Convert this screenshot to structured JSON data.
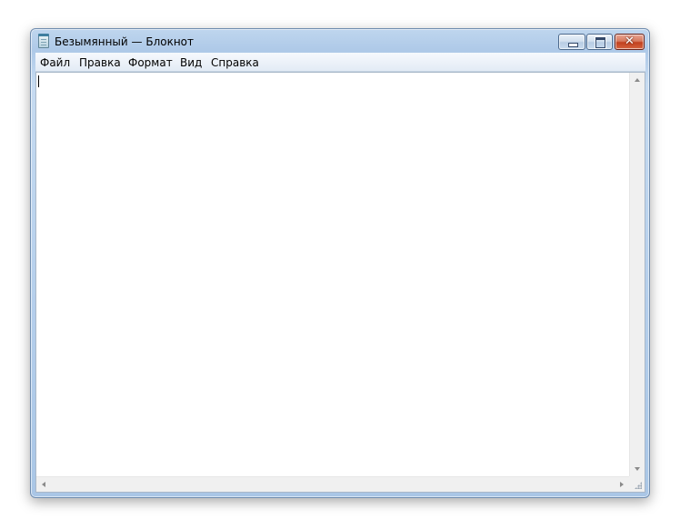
{
  "window": {
    "title": "Безымянный — Блокнот",
    "icon": "notepad-icon"
  },
  "controls": {
    "minimize_icon": "minimize-icon",
    "maximize_icon": "maximize-icon",
    "close_glyph": "✕"
  },
  "menu": {
    "items": [
      {
        "label": "Файл"
      },
      {
        "label": "Правка"
      },
      {
        "label": "Формат"
      },
      {
        "label": "Вид"
      },
      {
        "label": "Справка"
      }
    ]
  },
  "editor": {
    "content": ""
  },
  "colors": {
    "frame": "#b5cfec",
    "close_button": "#c2411f",
    "editor_bg": "#ffffff",
    "scrollbar_bg": "#f0f0f0"
  }
}
